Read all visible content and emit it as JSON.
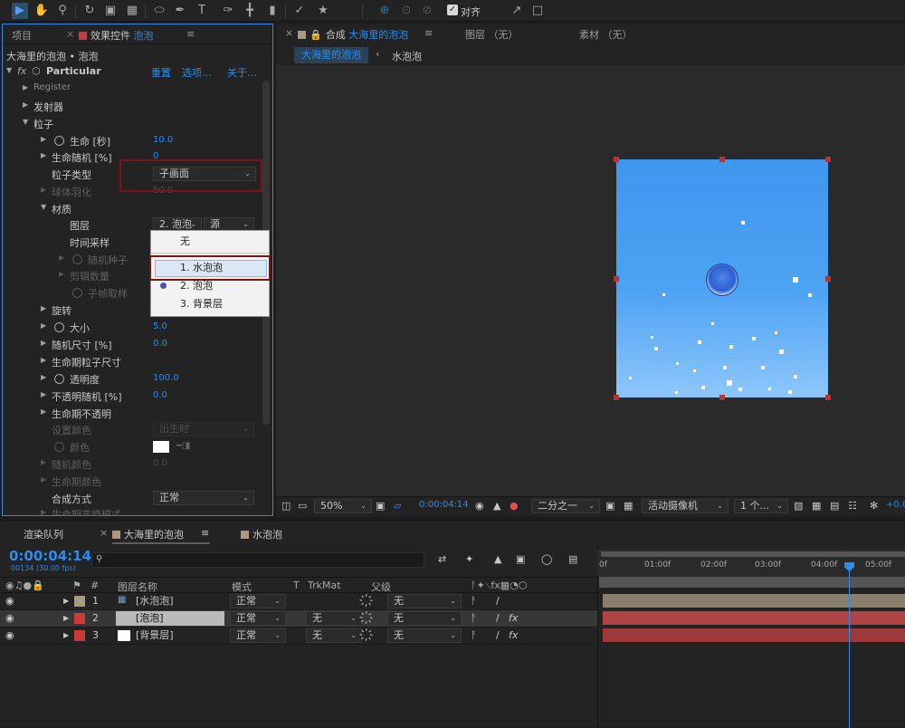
{
  "toolbar": {
    "snap_label": "对齐"
  },
  "effect_panel": {
    "tab_project": "项目",
    "tab_effect_prefix": "效果控件",
    "tab_effect_layer": "泡泡",
    "breadcrumb": "大海里的泡泡 • 泡泡",
    "effect_name": "Particular",
    "reset": "重置",
    "options": "选项...",
    "about": "关于...",
    "rows": {
      "register": "Register",
      "emitter": "发射器",
      "particle": "粒子",
      "life": "生命 [秒]",
      "life_val": "10.0",
      "life_random": "生命随机 [%]",
      "life_random_val": "0",
      "particle_type": "粒子类型",
      "particle_type_val": "子画面",
      "sphere_feather": "球体羽化",
      "sphere_feather_val": "50.0",
      "material": "材质",
      "layer": "图层",
      "layer_val": "2. 泡泡",
      "layer_src": "源",
      "time_sampling": "时间采样",
      "random_seed": "随机种子",
      "clip_count": "剪辑数量",
      "subframe": "子帧取样",
      "rotation": "旋转",
      "size": "大小",
      "size_val": "5.0",
      "size_random": "随机尺寸 [%]",
      "size_random_val": "0.0",
      "size_over_life": "生命期粒子尺寸",
      "opacity": "透明度",
      "opacity_val": "100.0",
      "opacity_random": "不透明随机 [%]",
      "opacity_random_val": "0.0",
      "opacity_over_life": "生命期不透明",
      "set_color": "设置颜色",
      "set_color_val": "出生时",
      "color": "颜色",
      "random_color": "随机颜色",
      "random_color_val": "0.0",
      "color_over_life": "生命期颜色",
      "blend_mode": "合成方式",
      "blend_mode_val": "正常",
      "transfer_mode_life": "生命期变换模式"
    },
    "dropdown": {
      "none": "无",
      "item1": "1. 水泡泡",
      "item2": "2. 泡泡",
      "item3": "3. 背景层"
    }
  },
  "comp_panel": {
    "tab_label": "合成",
    "comp_name": "大海里的泡泡",
    "layer_tab": "图层 （无）",
    "footage_tab": "素材 （无）",
    "crumb_active": "大海里的泡泡",
    "crumb_next": "水泡泡",
    "zoom": "50%",
    "timecode": "0:00:04:14",
    "resolution": "二分之一",
    "camera": "活动摄像机",
    "views": "1 个...",
    "exposure": "+0.0"
  },
  "timeline": {
    "tab_render": "渲染队列",
    "tab_comp": "大海里的泡泡",
    "tab_other": "水泡泡",
    "timecode": "0:00:04:14",
    "fps": "00134 (30.00 fps)",
    "headers": {
      "num": "#",
      "name": "图层名称",
      "mode": "模式",
      "t": "T",
      "trkmat": "TrkMat",
      "parent": "父级"
    },
    "layers": [
      {
        "num": "1",
        "name": "[水泡泡]",
        "mode": "正常",
        "trkmat": "",
        "parent": "无"
      },
      {
        "num": "2",
        "name": "[泡泡]",
        "mode": "正常",
        "trkmat": "无",
        "parent": "无"
      },
      {
        "num": "3",
        "name": "[背景层]",
        "mode": "正常",
        "trkmat": "无",
        "parent": "无"
      }
    ],
    "ruler": [
      "0f",
      "01:00f",
      "02:00f",
      "03:00f",
      "04:00f",
      "05:00f"
    ]
  },
  "colors": {
    "accent": "#2d8ceb",
    "highlight_box": "#7b1416",
    "layer1": "#a89a83",
    "layer2": "#c93b3b",
    "layer3": "#c93b3b"
  }
}
